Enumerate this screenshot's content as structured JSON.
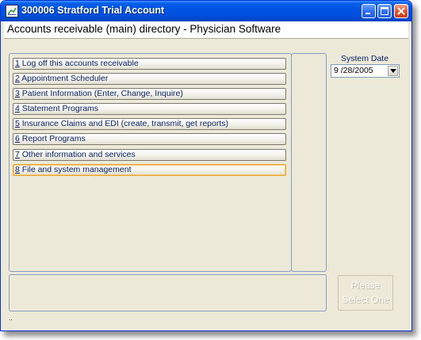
{
  "window": {
    "title": "300006 Stratford Trial Account",
    "accent": "#0054e3"
  },
  "header": {
    "title": "Accounts receivable (main) directory - Physician Software"
  },
  "menu": {
    "items": [
      {
        "num": "1",
        "label": " Log off this accounts receivable"
      },
      {
        "num": "2",
        "label": " Appointment Scheduler"
      },
      {
        "num": "3",
        "label": " Patient Information (Enter, Change, Inquire)"
      },
      {
        "num": "4",
        "label": " Statement Programs"
      },
      {
        "num": "5",
        "label": " Insurance Claims and EDI (create, transmit, get reports)"
      },
      {
        "num": "6",
        "label": " Report Programs"
      },
      {
        "num": "7",
        "label": " Other information and services"
      },
      {
        "num": "8",
        "label": " File and system management"
      }
    ]
  },
  "system_date": {
    "label": "System Date",
    "value": "9 /28/2005"
  },
  "select_button": {
    "line1": "Please",
    "line2": "Select One"
  },
  "status": {
    "dots": ".."
  }
}
